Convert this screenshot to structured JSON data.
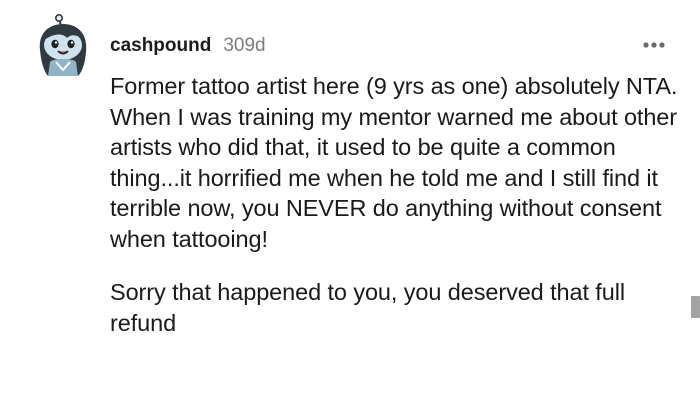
{
  "comment": {
    "author": "cashpound",
    "age": "309d",
    "more_icon": "more-horizontal-icon",
    "avatar_icon": "snoo-avatar",
    "paragraphs": [
      "Former tattoo artist here (9 yrs as one) absolutely NTA. When I was training my mentor warned me about other artists who did that, it used to be quite a common thing...it horrified me when he told me and I still find it terrible now, you NEVER do anything without consent when tattooing!",
      "Sorry that happened to you, you deserved that full refund"
    ]
  },
  "colors": {
    "text": "#1a1a1b",
    "meta": "#7c7c7c",
    "avatar_skin": "#cfe3ee",
    "avatar_hair": "#2f3b40",
    "scrollbar": "#a3a3a3"
  }
}
